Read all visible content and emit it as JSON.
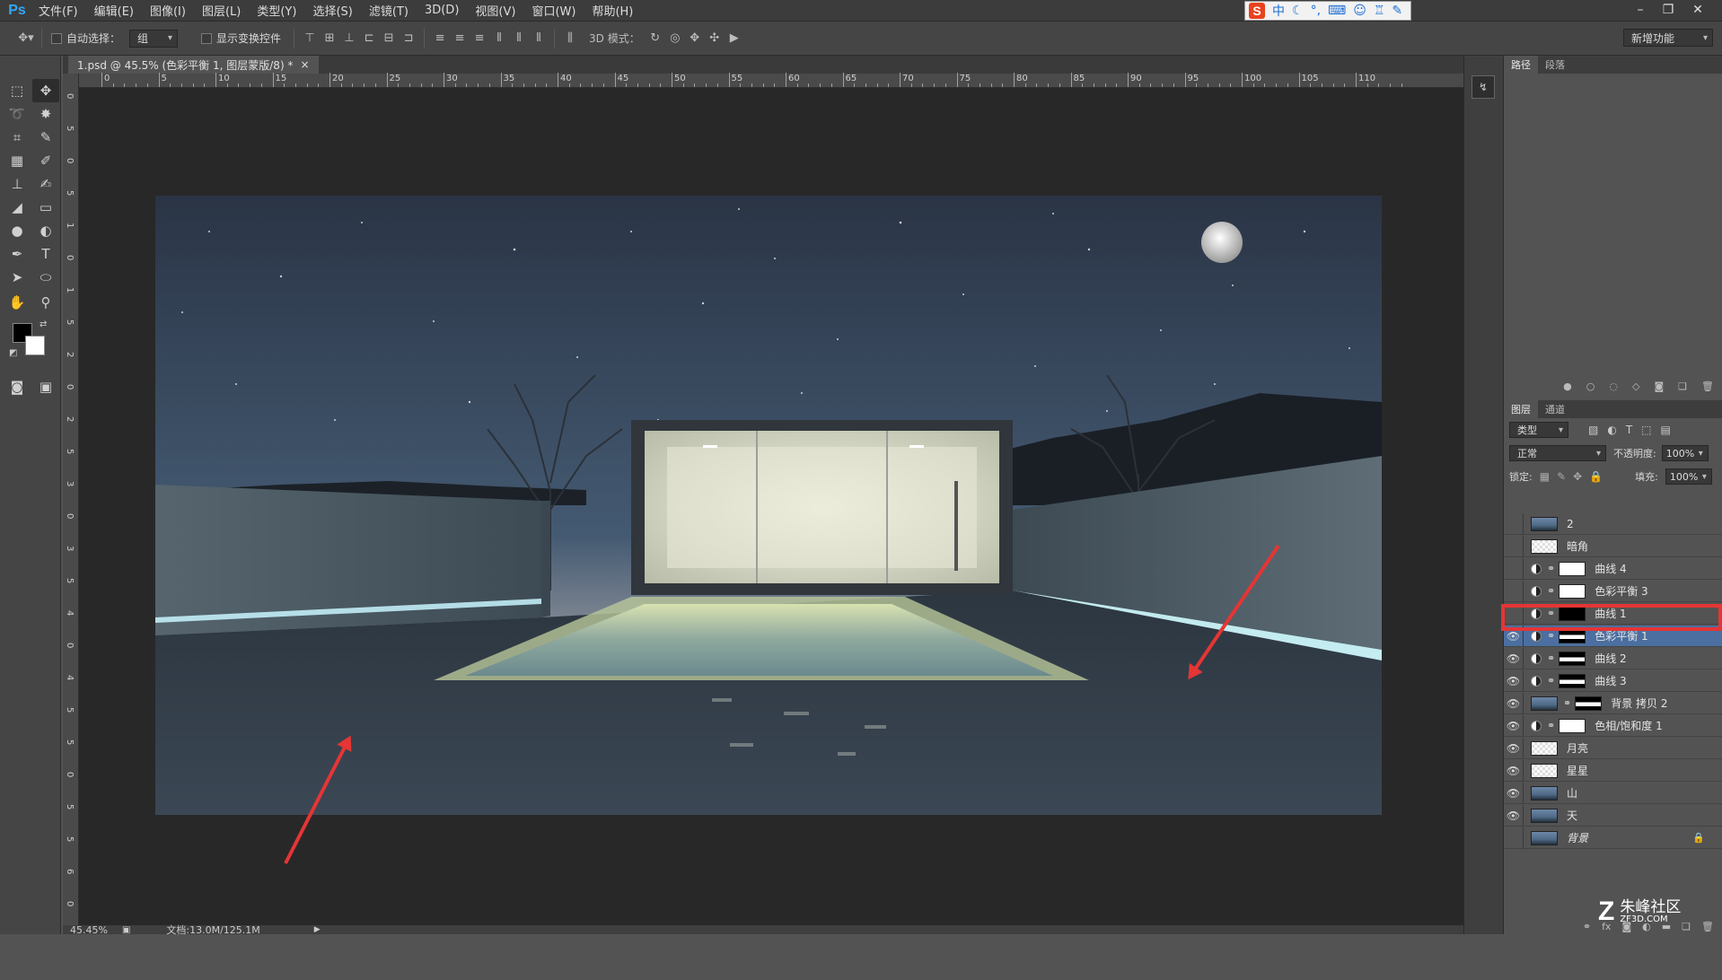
{
  "app": {
    "logo": "Ps"
  },
  "menu": [
    "文件(F)",
    "编辑(E)",
    "图像(I)",
    "图层(L)",
    "类型(Y)",
    "选择(S)",
    "滤镜(T)",
    "3D(D)",
    "视图(V)",
    "窗口(W)",
    "帮助(H)"
  ],
  "ime": {
    "brand": "S",
    "mode": "中"
  },
  "options": {
    "auto_select_label": "自动选择：",
    "auto_select_value": "组",
    "show_transform_label": "显示变换控件",
    "mode_3d_label": "3D 模式：",
    "workspace": "新增功能"
  },
  "document": {
    "tab_title": "1.psd @ 45.5% (色彩平衡 1, 图层蒙版/8) *",
    "close_glyph": "×",
    "zoom": "45.45%",
    "doc_info": "文档:13.0M/125.1M"
  },
  "ruler_h": [
    "0",
    "5",
    "10",
    "15",
    "20",
    "25",
    "30",
    "35",
    "40",
    "45",
    "50",
    "55",
    "60",
    "65",
    "70",
    "75",
    "80",
    "85",
    "90",
    "95",
    "100",
    "105",
    "110"
  ],
  "ruler_v": [
    "0",
    "5",
    "0",
    "5",
    "1",
    "0",
    "1",
    "5",
    "2",
    "0",
    "2",
    "5",
    "3",
    "0",
    "3",
    "5",
    "4",
    "0",
    "4",
    "5",
    "5",
    "0",
    "5",
    "5",
    "6",
    "0"
  ],
  "panels": {
    "top_tabs": [
      "路径",
      "段落"
    ],
    "layers_tabs": [
      "图层",
      "通道"
    ],
    "filter_kind": "类型",
    "blend_mode": "正常",
    "opacity_label": "不透明度:",
    "opacity_value": "100%",
    "lock_label": "锁定:",
    "fill_label": "填充:",
    "fill_value": "100%"
  },
  "layers": [
    {
      "name": "2",
      "visible": false,
      "kind": "image"
    },
    {
      "name": "暗角",
      "visible": false,
      "kind": "pixel"
    },
    {
      "name": "曲线 4",
      "visible": false,
      "kind": "adjust",
      "mask": "white"
    },
    {
      "name": "色彩平衡 3",
      "visible": false,
      "kind": "adjust",
      "mask": "white"
    },
    {
      "name": "曲线 1",
      "visible": false,
      "kind": "adjust",
      "mask": "black"
    },
    {
      "name": "色彩平衡 1",
      "visible": true,
      "kind": "adjust",
      "mask": "shape",
      "selected": true
    },
    {
      "name": "曲线 2",
      "visible": true,
      "kind": "adjust",
      "mask": "shape"
    },
    {
      "name": "曲线 3",
      "visible": true,
      "kind": "adjust",
      "mask": "shape"
    },
    {
      "name": "背景 拷贝 2",
      "visible": true,
      "kind": "image",
      "mask": "shape"
    },
    {
      "name": "色相/饱和度 1",
      "visible": true,
      "kind": "adjust",
      "mask": "white"
    },
    {
      "name": "月亮",
      "visible": true,
      "kind": "pixel"
    },
    {
      "name": "星星",
      "visible": true,
      "kind": "pixel"
    },
    {
      "name": "山",
      "visible": true,
      "kind": "image"
    },
    {
      "name": "天",
      "visible": true,
      "kind": "image"
    },
    {
      "name": "背景",
      "visible": false,
      "kind": "image",
      "locked": true
    }
  ],
  "watermark": {
    "text": "朱峰社区",
    "sub": "ZF3D.COM"
  },
  "colors": {
    "accent": "#31a8ff",
    "highlight_box": "#e53535",
    "selected_layer": "#4b6fa0"
  }
}
